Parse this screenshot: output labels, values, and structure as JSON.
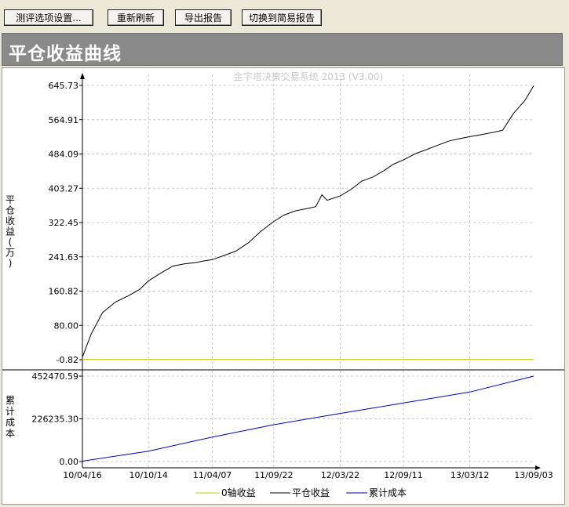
{
  "toolbar": {
    "buttons": [
      {
        "label": "测评选项设置..."
      },
      {
        "label": "重新刷新"
      },
      {
        "label": "导出报告"
      },
      {
        "label": "切换到简易报告"
      }
    ]
  },
  "header": {
    "title": "平仓收益曲线"
  },
  "chart_data": {
    "type": "line",
    "watermark": "金字塔决策交易系统 2013 (V3.00)",
    "x_ticks": [
      "10/04/16",
      "10/10/14",
      "11/04/07",
      "11/09/22",
      "12/03/22",
      "12/09/11",
      "13/03/12",
      "13/09/03"
    ],
    "top_panel": {
      "ylabel": "平仓收益(万)",
      "y_ticks": [
        "645.73",
        "564.91",
        "484.09",
        "403.27",
        "322.45",
        "241.63",
        "160.82",
        "80.00",
        "-0.82"
      ],
      "ylim": [
        -0.82,
        645.73
      ],
      "series": [
        {
          "name": "0轴收益",
          "color": "#C8C800",
          "x": [
            "10/04/16",
            "13/09/03"
          ],
          "values": [
            0,
            0
          ]
        },
        {
          "name": "平仓收益",
          "color": "#000000",
          "x": [
            "10/04/16",
            "10/05/10",
            "10/06/10",
            "10/07/15",
            "10/08/20",
            "10/09/20",
            "10/10/14",
            "10/11/20",
            "10/12/20",
            "11/01/20",
            "11/02/20",
            "11/03/15",
            "11/04/07",
            "11/05/10",
            "11/06/10",
            "11/07/15",
            "11/08/15",
            "11/09/22",
            "11/10/20",
            "11/11/20",
            "11/12/20",
            "12/01/15",
            "12/02/01",
            "12/02/15",
            "12/03/22",
            "12/04/20",
            "12/05/20",
            "12/06/20",
            "12/07/20",
            "12/08/15",
            "12/09/11",
            "12/10/15",
            "12/11/15",
            "12/12/15",
            "13/01/15",
            "13/02/10",
            "13/03/12",
            "13/04/15",
            "13/05/15",
            "13/06/10",
            "13/07/10",
            "13/08/10",
            "13/09/03"
          ],
          "values": [
            5,
            60,
            110,
            135,
            150,
            165,
            185,
            205,
            220,
            225,
            228,
            232,
            235,
            245,
            255,
            275,
            300,
            325,
            340,
            350,
            355,
            360,
            388,
            375,
            385,
            400,
            420,
            430,
            445,
            460,
            470,
            485,
            495,
            505,
            515,
            520,
            525,
            530,
            535,
            540,
            580,
            610,
            645
          ]
        }
      ]
    },
    "bottom_panel": {
      "ylabel": "累计成本",
      "y_ticks": [
        "452470.59",
        "226235.30",
        "0.00"
      ],
      "ylim": [
        0,
        452470.59
      ],
      "series": [
        {
          "name": "累计成本",
          "color": "#0000C0",
          "x": [
            "10/04/16",
            "10/10/14",
            "11/04/07",
            "11/09/22",
            "12/03/22",
            "12/09/11",
            "13/03/12",
            "13/09/03"
          ],
          "values": [
            2000,
            55000,
            130000,
            195000,
            255000,
            310000,
            368000,
            452470.59
          ]
        }
      ]
    },
    "legend": {
      "placement": "bottom-center",
      "items": [
        "0轴收益",
        "平仓收益",
        "累计成本"
      ]
    },
    "grid": true
  }
}
